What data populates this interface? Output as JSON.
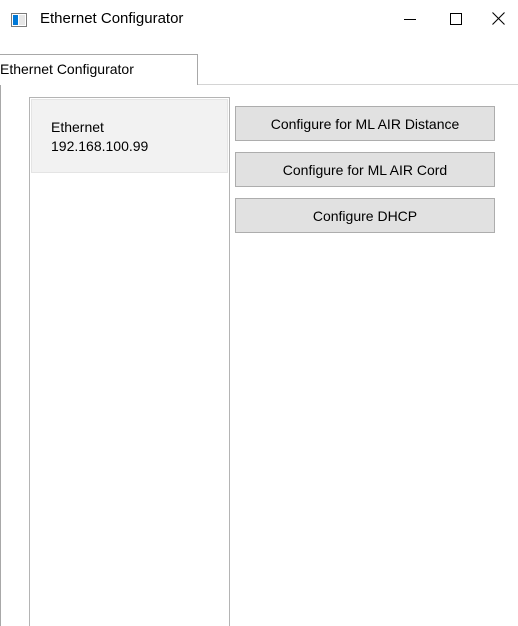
{
  "window": {
    "title": "Ethernet Configurator",
    "icon": "app-window-icon",
    "controls": {
      "minimize_icon": "minimize-icon",
      "maximize_icon": "maximize-icon",
      "close_icon": "close-icon"
    }
  },
  "tabs": [
    {
      "label": "Ethernet Configurator",
      "selected": true
    }
  ],
  "adapter_list": {
    "items": [
      {
        "name": "Ethernet",
        "address": "192.168.100.99"
      }
    ]
  },
  "actions": {
    "configure_distance_label": "Configure for ML AIR Distance",
    "configure_cord_label": "Configure for ML AIR Cord",
    "configure_dhcp_label": "Configure DHCP"
  },
  "colors": {
    "button_face": "#e1e1e1",
    "button_border": "#adadad",
    "list_item_selected": "#f2f2f2",
    "icon_accent": "#0078d7"
  }
}
